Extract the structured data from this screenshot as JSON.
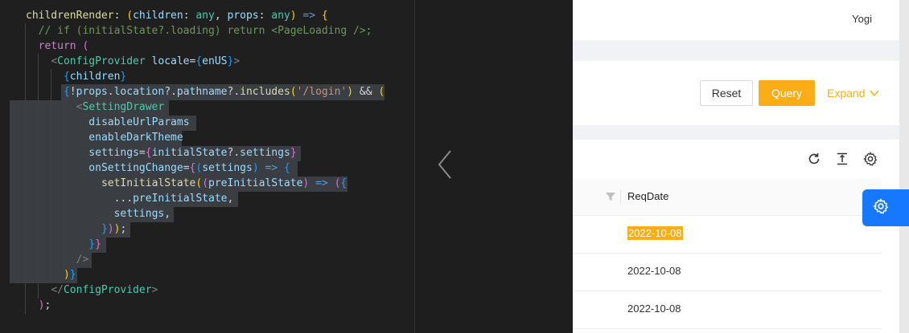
{
  "editor": {
    "lines": [
      {
        "indent": 2,
        "parts": [
          [
            "t-fn",
            "childrenRender"
          ],
          [
            "t-def",
            ": "
          ],
          [
            "t-br1",
            "("
          ],
          [
            "t-var",
            "children"
          ],
          [
            "t-def",
            ": "
          ],
          [
            "t-typ",
            "any"
          ],
          [
            "t-def",
            ", "
          ],
          [
            "t-var",
            "props"
          ],
          [
            "t-def",
            ": "
          ],
          [
            "t-typ",
            "any"
          ],
          [
            "t-br1",
            ")"
          ],
          [
            "t-def",
            " "
          ],
          [
            "t-blue",
            "=>"
          ],
          [
            "t-def",
            " "
          ],
          [
            "t-br1",
            "{"
          ]
        ]
      },
      {
        "indent": 4,
        "parts": [
          [
            "t-cmt",
            "// if (initialState?.loading) return <PageLoading />;"
          ]
        ]
      },
      {
        "indent": 4,
        "parts": [
          [
            "t-kw",
            "return"
          ],
          [
            "t-def",
            " "
          ],
          [
            "t-br2",
            "("
          ]
        ]
      },
      {
        "indent": 6,
        "parts": [
          [
            "t-punc",
            "<"
          ],
          [
            "t-tag",
            "ConfigProvider"
          ],
          [
            "t-def",
            " "
          ],
          [
            "t-attr",
            "locale"
          ],
          [
            "t-def",
            "="
          ],
          [
            "t-br3",
            "{"
          ],
          [
            "t-var",
            "enUS"
          ],
          [
            "t-br3",
            "}"
          ],
          [
            "t-punc",
            ">"
          ]
        ]
      },
      {
        "indent": 8,
        "parts": [
          [
            "t-br3",
            "{"
          ],
          [
            "t-var",
            "children"
          ],
          [
            "t-br3",
            "}"
          ]
        ]
      },
      {
        "indent": 8,
        "parts": [
          [
            "t-br3",
            "{"
          ],
          [
            "t-def",
            "!"
          ],
          [
            "t-var",
            "props"
          ],
          [
            "t-def",
            "."
          ],
          [
            "t-var",
            "location"
          ],
          [
            "t-def",
            "?."
          ],
          [
            "t-var",
            "pathname"
          ],
          [
            "t-def",
            "?."
          ],
          [
            "t-fn",
            "includes"
          ],
          [
            "t-br1",
            "("
          ],
          [
            "t-str",
            "'/login'"
          ],
          [
            "t-br1",
            ")"
          ],
          [
            "t-def",
            " && "
          ],
          [
            "t-br1",
            "("
          ]
        ]
      },
      {
        "indent": 10,
        "parts": [
          [
            "t-punc",
            "<"
          ],
          [
            "t-tag",
            "SettingDrawer"
          ]
        ]
      },
      {
        "indent": 12,
        "parts": [
          [
            "t-attr",
            "disableUrlParams"
          ]
        ]
      },
      {
        "indent": 12,
        "parts": [
          [
            "t-attr",
            "enableDarkTheme"
          ]
        ]
      },
      {
        "indent": 12,
        "parts": [
          [
            "t-attr",
            "settings"
          ],
          [
            "t-def",
            "="
          ],
          [
            "t-br2",
            "{"
          ],
          [
            "t-var",
            "initialState"
          ],
          [
            "t-def",
            "?."
          ],
          [
            "t-var",
            "settings"
          ],
          [
            "t-br2",
            "}"
          ]
        ]
      },
      {
        "indent": 12,
        "parts": [
          [
            "t-attr",
            "onSettingChange"
          ],
          [
            "t-def",
            "="
          ],
          [
            "t-br2",
            "{"
          ],
          [
            "t-br3",
            "("
          ],
          [
            "t-var",
            "settings"
          ],
          [
            "t-br3",
            ")"
          ],
          [
            "t-def",
            " "
          ],
          [
            "t-blue",
            "=>"
          ],
          [
            "t-def",
            " "
          ],
          [
            "t-br3",
            "{"
          ]
        ]
      },
      {
        "indent": 14,
        "parts": [
          [
            "t-fn",
            "setInitialState"
          ],
          [
            "t-br1",
            "("
          ],
          [
            "t-br2",
            "("
          ],
          [
            "t-var",
            "preInitialState"
          ],
          [
            "t-br2",
            ")"
          ],
          [
            "t-def",
            " "
          ],
          [
            "t-blue",
            "=>"
          ],
          [
            "t-def",
            " "
          ],
          [
            "t-br2",
            "("
          ],
          [
            "t-br3",
            "{"
          ]
        ]
      },
      {
        "indent": 16,
        "parts": [
          [
            "t-def",
            "..."
          ],
          [
            "t-var",
            "preInitialState"
          ],
          [
            "t-def",
            ","
          ]
        ]
      },
      {
        "indent": 16,
        "parts": [
          [
            "t-var",
            "settings"
          ],
          [
            "t-def",
            ","
          ]
        ]
      },
      {
        "indent": 14,
        "parts": [
          [
            "t-br3",
            "}"
          ],
          [
            "t-br2",
            ")"
          ],
          [
            "t-br1",
            ")"
          ],
          [
            "t-def",
            ";"
          ]
        ]
      },
      {
        "indent": 12,
        "parts": [
          [
            "t-br3",
            "}"
          ],
          [
            "t-br2",
            "}"
          ]
        ]
      },
      {
        "indent": 10,
        "parts": [
          [
            "t-punc",
            "/>"
          ]
        ]
      },
      {
        "indent": 8,
        "parts": [
          [
            "t-br1",
            ")"
          ],
          [
            "t-br3",
            "}"
          ]
        ]
      },
      {
        "indent": 6,
        "parts": [
          [
            "t-punc",
            "</"
          ],
          [
            "t-tag",
            "ConfigProvider"
          ],
          [
            "t-punc",
            ">"
          ]
        ]
      },
      {
        "indent": 4,
        "parts": [
          [
            "t-br2",
            ")"
          ],
          [
            "t-def",
            ";"
          ]
        ]
      }
    ]
  },
  "navigation": {
    "prev_icon": "chevron-left-icon"
  },
  "header": {
    "username": "Yogi"
  },
  "search_form": {
    "reset_label": "Reset",
    "query_label": "Query",
    "expand_label": "Expand",
    "expand_icon": "chevron-down-icon"
  },
  "table": {
    "toolbar_icons": [
      "reload-icon",
      "density-icon",
      "settings-icon"
    ],
    "filter_icon": "filter-icon",
    "column_header": "ReqDate",
    "rows": [
      "2022-10-08",
      "2022-10-08",
      "2022-10-08"
    ],
    "highlighted_row": 0
  },
  "floating_button": {
    "icon": "settings-icon"
  },
  "colors": {
    "primary": "#faad14",
    "floating": "#1677ff",
    "editor_bg": "#1f1f1f"
  }
}
